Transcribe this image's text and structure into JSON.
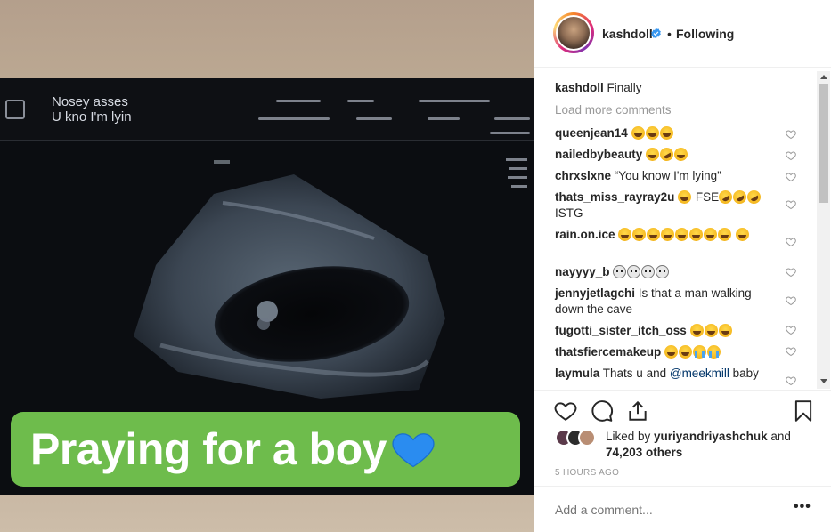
{
  "post": {
    "overlay_text": "Praying for a boy",
    "overlay_emoji": "blue-heart-icon",
    "monitor_text_line1": "Nosey asses",
    "monitor_text_line2": "U kno I'm lyin"
  },
  "header": {
    "username": "kashdoll",
    "separator": "•",
    "follow_state": "Following"
  },
  "caption": {
    "user": "kashdoll",
    "text": "Finally"
  },
  "load_more": "Load more comments",
  "comments": [
    {
      "user": "queenjean14",
      "text": "",
      "emojis": [
        "joy",
        "joy",
        "joy"
      ]
    },
    {
      "user": "nailedbybeauty",
      "text": "",
      "emojis": [
        "joy",
        "rofl",
        "joy"
      ]
    },
    {
      "user": "chrxslxne",
      "text": "“You know I'm lying”",
      "emojis": []
    },
    {
      "user": "thats_miss_rayray2u",
      "text_a": "FSE",
      "text_b": "ISTG",
      "emojis_a": [
        "joy"
      ],
      "emojis_b": [
        "rofl",
        "rofl",
        "rofl"
      ]
    },
    {
      "user": "rain.on.ice",
      "text": "",
      "emojis": [
        "joy",
        "joy",
        "joy",
        "joy",
        "joy",
        "joy",
        "joy",
        "joy",
        "joy"
      ]
    },
    {
      "user": "nayyyy_b",
      "text": "",
      "emojis": [
        "skull",
        "skull",
        "skull",
        "skull"
      ]
    },
    {
      "user": "jennyjetlagchi",
      "text": "Is that a man walking down the cave",
      "emojis": []
    },
    {
      "user": "fugotti_sister_itch_oss",
      "text": "",
      "emojis": [
        "joy",
        "joy",
        "joy"
      ]
    },
    {
      "user": "thatsfiercemakeup",
      "text": "",
      "emojis": [
        "joy",
        "joy",
        "sob",
        "sob"
      ]
    },
    {
      "user": "laymula",
      "text": "Thats u and ",
      "mention": "@meekmill",
      "text_after": " baby",
      "emojis": []
    }
  ],
  "likes": {
    "prefix": "Liked by ",
    "user": "yuriyandriyashchuk",
    "middle": " and",
    "count": "74,203 others"
  },
  "timestamp": "5 HOURS AGO",
  "add_comment_placeholder": "Add a comment...",
  "more_options": "•••",
  "colors": {
    "caption_bg": "#6ebc4c",
    "link": "#003569",
    "verified": "#3897f0"
  }
}
